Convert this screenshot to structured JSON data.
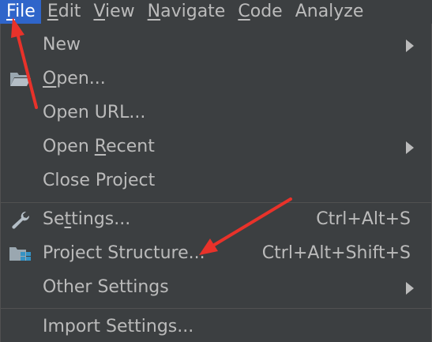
{
  "menubar": {
    "items": [
      {
        "label": "File",
        "mnemonic": "F",
        "rest": "ile"
      },
      {
        "label": "Edit",
        "mnemonic": "E",
        "rest": "dit"
      },
      {
        "label": "View",
        "mnemonic": "V",
        "rest": "iew"
      },
      {
        "label": "Navigate",
        "mnemonic": "N",
        "rest": "avigate"
      },
      {
        "label": "Code",
        "mnemonic": "C",
        "rest": "ode"
      },
      {
        "label": "Analyze",
        "mnemonic": "",
        "rest": "Analyze"
      }
    ]
  },
  "menu": {
    "new": {
      "label": "New"
    },
    "open": {
      "pre": "",
      "mn": "O",
      "post": "pen..."
    },
    "open_url": {
      "label": "Open URL..."
    },
    "open_recent": {
      "pre": "Open ",
      "mn": "R",
      "post": "ecent"
    },
    "close_project": {
      "label": "Close Project"
    },
    "settings": {
      "pre": "Se",
      "mn": "t",
      "post": "tings...",
      "shortcut": "Ctrl+Alt+S"
    },
    "project_structure": {
      "label": "Project Structure...",
      "shortcut": "Ctrl+Alt+Shift+S"
    },
    "other_settings": {
      "label": "Other Settings"
    },
    "import_settings": {
      "label": "Import Settings..."
    }
  },
  "colors": {
    "background": "#3c3f41",
    "text": "#bbbbbb",
    "active_menu": "#2f65ca",
    "annotation_arrow": "#e8322a"
  },
  "icons": {
    "open": "folder-open-icon",
    "settings": "wrench-icon",
    "project_structure": "project-structure-icon"
  }
}
